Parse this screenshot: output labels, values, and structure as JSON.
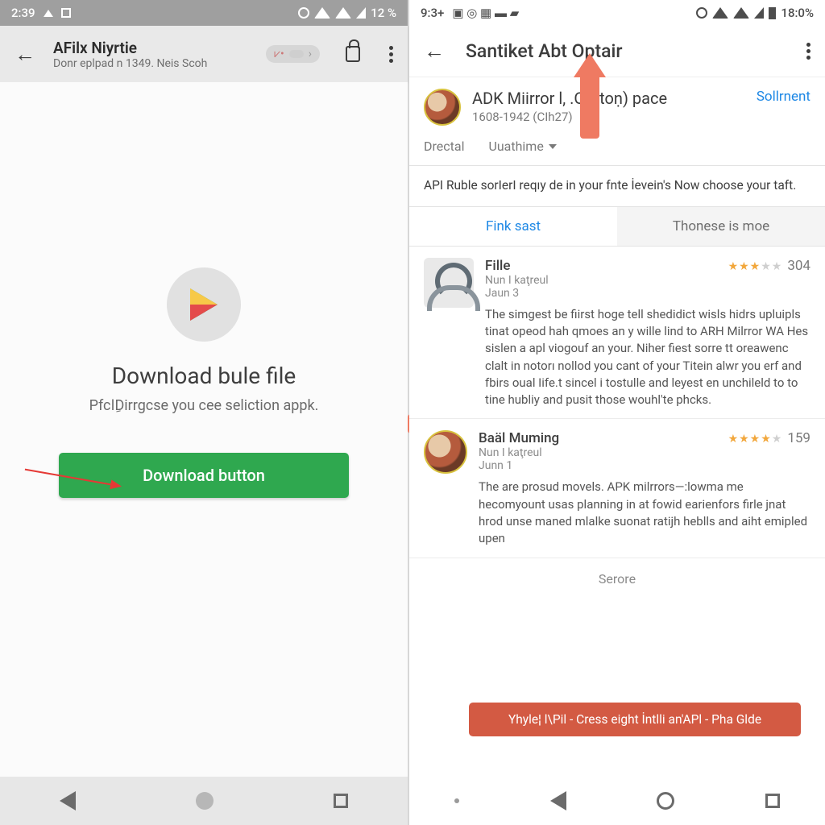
{
  "left": {
    "status": {
      "time": "2:39",
      "battery": "12 %"
    },
    "appbar": {
      "title": "AFilx Niyrtie",
      "subtitle": "Donr eplpad n 1349. Neis Scoh",
      "chip": "•"
    },
    "body": {
      "heading": "Download bule file",
      "sub": "PfclِDirrgcse you cee seliction appk.",
      "button": "Download button"
    }
  },
  "right": {
    "status": {
      "time": "9:3+",
      "battery": "18:0%"
    },
    "appbar": {
      "title": "Santiket Abt Optair"
    },
    "app": {
      "name": "ADK Miirror l,    .Orotoṇ) pace",
      "meta": "1608-1942 (CIh27)",
      "action": "Sollrnent"
    },
    "miniTabs": {
      "a": "Drectal",
      "b": "Uuathime"
    },
    "info": "API Ruble sorIerI reqıy de in your fnte İevein's Now choose your taft.",
    "tabs": {
      "active": "Fink sast",
      "other": "Thonese is moe"
    },
    "reviews": [
      {
        "name": "Fille",
        "sub": "Nun I kaţreul",
        "date": "Jaun 3",
        "stars": 3,
        "count": "304",
        "text": "The simgest be fiirst hoge tell shedidict wisls hidrs upluipls tinat opeod hah qmoes an y wille lind to ARH Milrror WA Hes sislen a apl­ viogouf an your. Niher fiest sorre tt oreawenc clalt in notorı nollod you cant of your Titein alwr you erf and fbirs oual Iife.t sincel i tostulle and leyest en unchileld to to tine hubliy and pusit those wouhl'te phcks."
      },
      {
        "name": "Baäl Muming",
        "sub": "Nun I kaţreul",
        "date": "Junn 1",
        "stars": 4,
        "count": "159",
        "text": "The are prosud movels. APK milrrors—:lowma me hecomyount usas planning in at fowid earienfors firle jnat hrod unse maned mlalke suonat ratijh heblls and aiht emipled upen"
      }
    ],
    "toast": "Yhyle¦ l\\Pil - Cress eight İntlli an'APl - Pha Glde",
    "more": "Serore"
  }
}
